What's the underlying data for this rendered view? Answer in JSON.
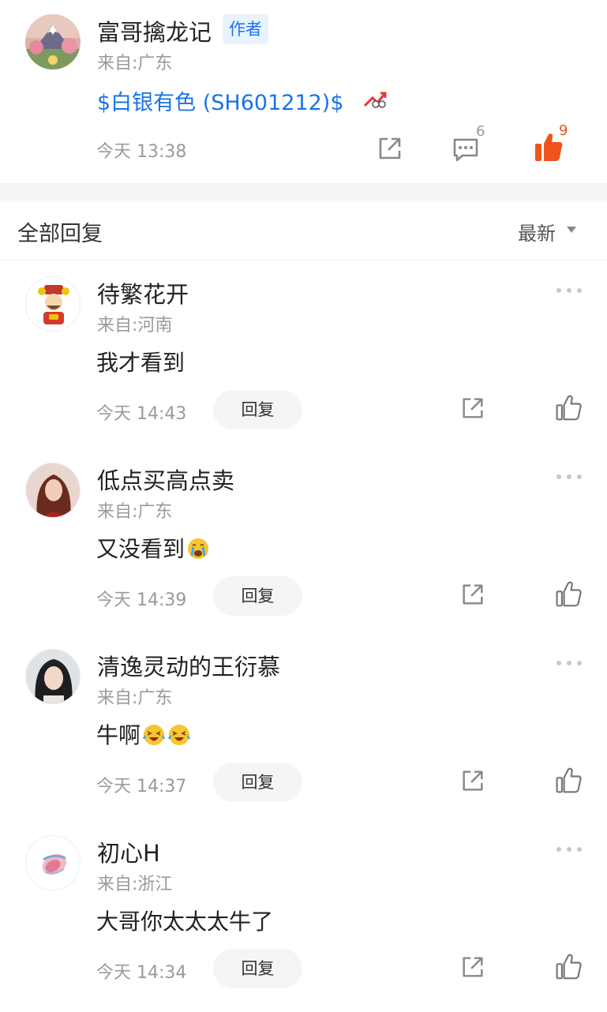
{
  "post": {
    "author": "富哥擒龙记",
    "badge": "作者",
    "location": "来自:广东",
    "stock": "$白银有色 (SH601212)$",
    "time": "今天 13:38",
    "comment_count": "6",
    "like_count": "9",
    "icons": {
      "share": "share-icon",
      "comment": "comment-icon",
      "like": "thumbs-up-filled-icon",
      "trend": "trend-up-icon"
    },
    "colors": {
      "link": "#1a73e8",
      "like": "#f0531c"
    }
  },
  "replies_header": {
    "title": "全部回复",
    "sort": "最新"
  },
  "replies": [
    {
      "name": "待繁花开",
      "location": "来自:河南",
      "content": "我才看到",
      "time": "今天 14:43",
      "reply_label": "回复"
    },
    {
      "name": "低点买高点卖",
      "location": "来自:广东",
      "content": "又没看到",
      "time": "今天 14:39",
      "reply_label": "回复"
    },
    {
      "name": "清逸灵动的王衍慕",
      "location": "来自:广东",
      "content": "牛啊",
      "time": "今天 14:37",
      "reply_label": "回复"
    },
    {
      "name": "初心H",
      "location": "来自:浙江",
      "content": "大哥你太太太牛了",
      "time": "今天 14:34",
      "reply_label": "回复"
    }
  ]
}
